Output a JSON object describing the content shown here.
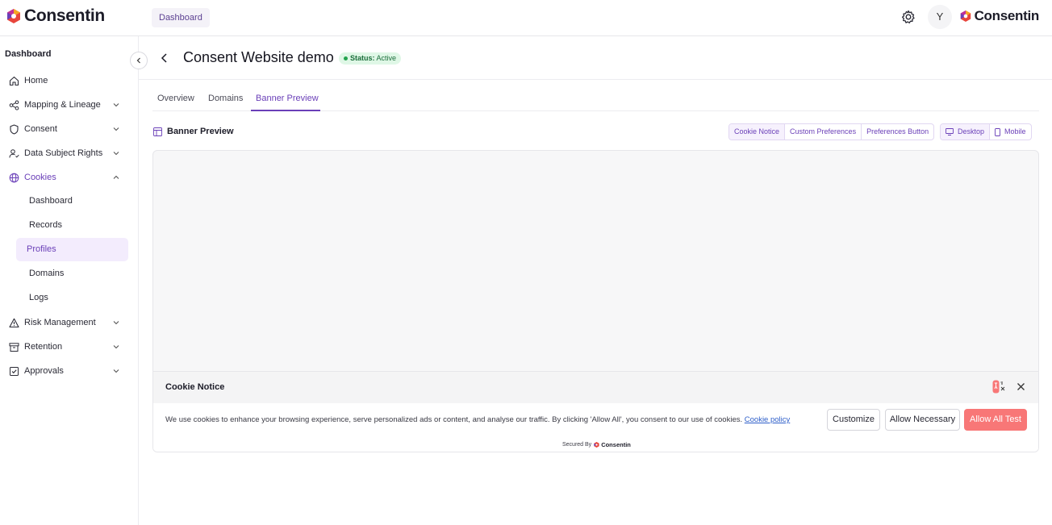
{
  "brand": {
    "name": "Consentin",
    "colors": {
      "primary": "#6a3fb8",
      "accent_button": "#f87777",
      "status_green": "#24a34e"
    }
  },
  "topbar": {
    "tab_label": "Dashboard",
    "settings_icon": "gear-icon",
    "avatar_initial": "Y",
    "right_logo_text": "Consentin"
  },
  "sidebar": {
    "title": "Dashboard",
    "items": [
      {
        "label": "Home",
        "icon": "home-icon"
      },
      {
        "label": "Mapping & Lineage",
        "icon": "share-nodes-icon"
      },
      {
        "label": "Consent",
        "icon": "shield-icon"
      },
      {
        "label": "Data Subject Rights",
        "icon": "user-check-icon"
      },
      {
        "label": "Cookies",
        "icon": "globe-icon"
      },
      {
        "label": "Risk Management",
        "icon": "warning-icon"
      },
      {
        "label": "Retention",
        "icon": "archive-icon"
      },
      {
        "label": "Approvals",
        "icon": "checkbox-icon"
      }
    ],
    "cookies_children": [
      "Dashboard",
      "Records",
      "Profiles",
      "Domains",
      "Logs"
    ],
    "active_child": "Profiles"
  },
  "header": {
    "title": "Consent Website demo",
    "status_label": "Status:",
    "status_value": "Active"
  },
  "tabs": [
    "Overview",
    "Domains",
    "Banner Preview"
  ],
  "active_tab": "Banner Preview",
  "preview": {
    "title": "Banner Preview",
    "view_options": [
      "Cookie Notice",
      "Custom Preferences",
      "Preferences Button"
    ],
    "selected_view": "Cookie Notice",
    "device_options": [
      "Desktop",
      "Mobile"
    ]
  },
  "cookie_banner": {
    "title": "Cookie Notice",
    "text": "We use cookies to enhance your browsing experience, serve personalized ads or content, and analyse our traffic. By clicking 'Allow All', you consent to our use of cookies.",
    "link_text": "Cookie policy",
    "buttons": {
      "customize": "Customize",
      "necessary": "Allow Necessary",
      "allow_all": "Allow All Test"
    },
    "secured_by": "Secured By",
    "secured_brand": "Consentin"
  }
}
